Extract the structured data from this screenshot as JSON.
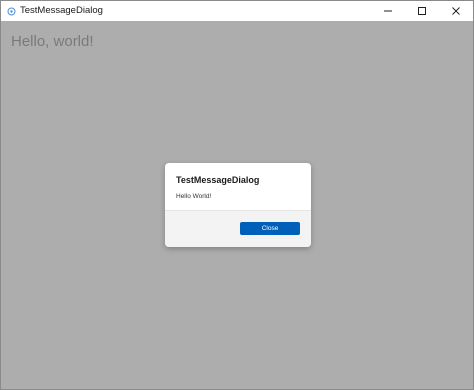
{
  "window": {
    "title": "TestMessageDialog"
  },
  "main": {
    "greeting": "Hello, world!"
  },
  "dialog": {
    "title": "TestMessageDialog",
    "message": "Hello World!",
    "close_label": "Close"
  },
  "colors": {
    "overlay": "#adadad",
    "accent": "#005fb8"
  }
}
